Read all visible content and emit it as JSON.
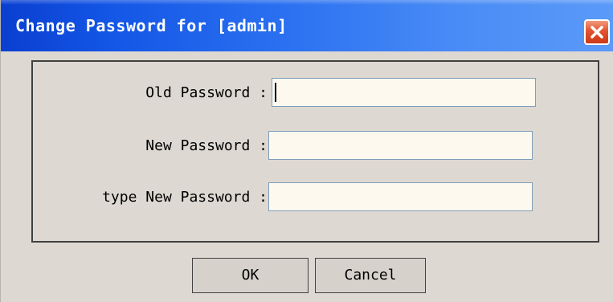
{
  "dialog": {
    "title": "Change Password for [admin]",
    "close_icon": "close-icon"
  },
  "form": {
    "old_password_label": "Old Password :",
    "old_password_value": "",
    "new_password_label": "New Password :",
    "new_password_value": "",
    "retype_password_label": "type New Password :",
    "retype_password_value": ""
  },
  "buttons": {
    "ok_label": "OK",
    "cancel_label": "Cancel"
  },
  "colors": {
    "titlebar": "#1456e6",
    "close_button": "#e2532f",
    "dialog_background": "#ddd9d2",
    "input_background": "#fdf9ef"
  }
}
